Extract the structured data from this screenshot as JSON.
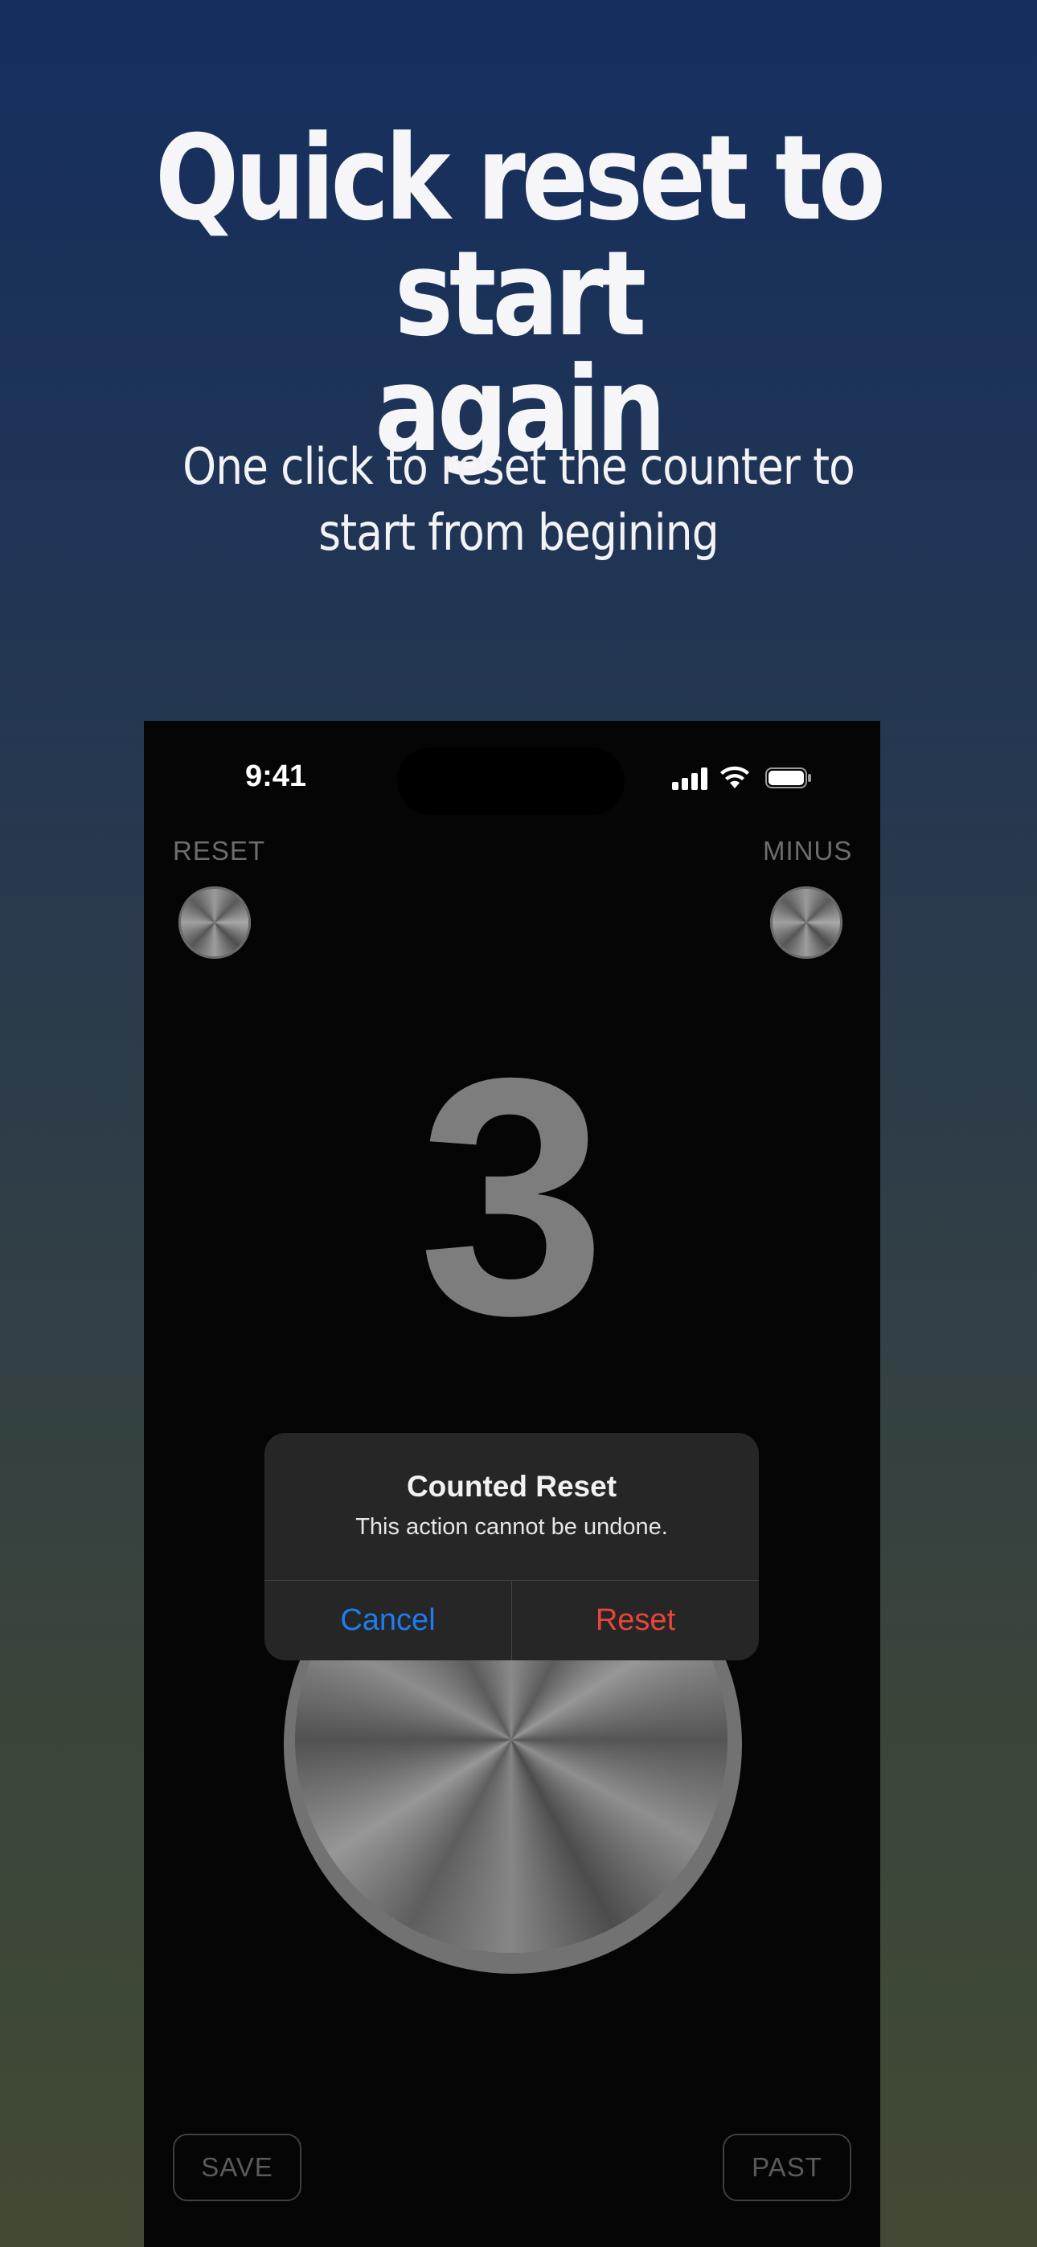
{
  "promo": {
    "headline_line1": "Quick reset to start",
    "headline_line2": "again",
    "subhead_line1": "One click to reset the counter to",
    "subhead_line2": "start from begining"
  },
  "status_bar": {
    "time": "9:41"
  },
  "controls": {
    "reset_label": "RESET",
    "minus_label": "MINUS",
    "save_label": "SAVE",
    "past_label": "PAST"
  },
  "counter": {
    "value": "3"
  },
  "alert": {
    "title": "Counted Reset",
    "message": "This action cannot be undone.",
    "cancel_label": "Cancel",
    "reset_label": "Reset"
  },
  "colors": {
    "cancel": "#1f7cf0",
    "destructive": "#e8453c"
  }
}
